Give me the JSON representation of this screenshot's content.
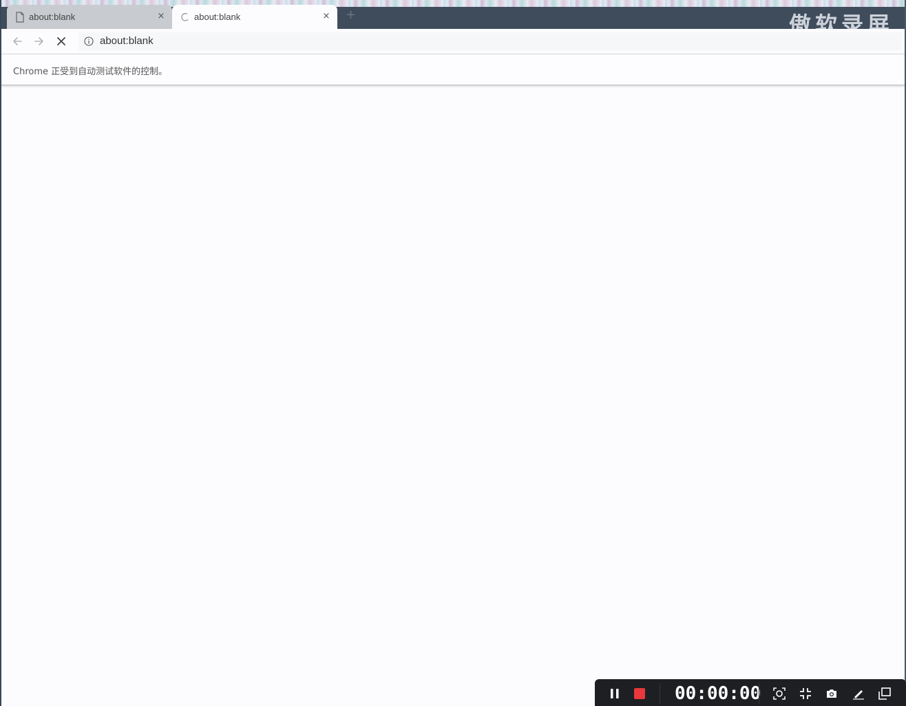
{
  "tabs": [
    {
      "title": "about:blank",
      "state": "inactive",
      "close_glyph": "×"
    },
    {
      "title": "about:blank",
      "state": "active-loading",
      "close_glyph": "×"
    }
  ],
  "new_tab_glyph": "+",
  "watermark": "傲软录屏",
  "toolbar": {
    "url": "about:blank",
    "back_icon": "back-arrow-icon",
    "forward_icon": "forward-arrow-icon",
    "stop_icon": "stop-icon"
  },
  "infobar": {
    "message": "Chrome 正受到自动测试软件的控制。"
  },
  "recorder": {
    "time": "00:00:00",
    "stop_color": "#e8383d",
    "buttons": [
      "pause-icon",
      "stop-record-icon",
      "region-capture-icon",
      "exit-fullscreen-icon",
      "camera-icon",
      "pen-icon",
      "minimize-window-icon"
    ]
  },
  "colors": {
    "tabstrip": "#3f4c5c",
    "page_background": "#fcfcfe",
    "recorder_background": "#1d1f23"
  }
}
